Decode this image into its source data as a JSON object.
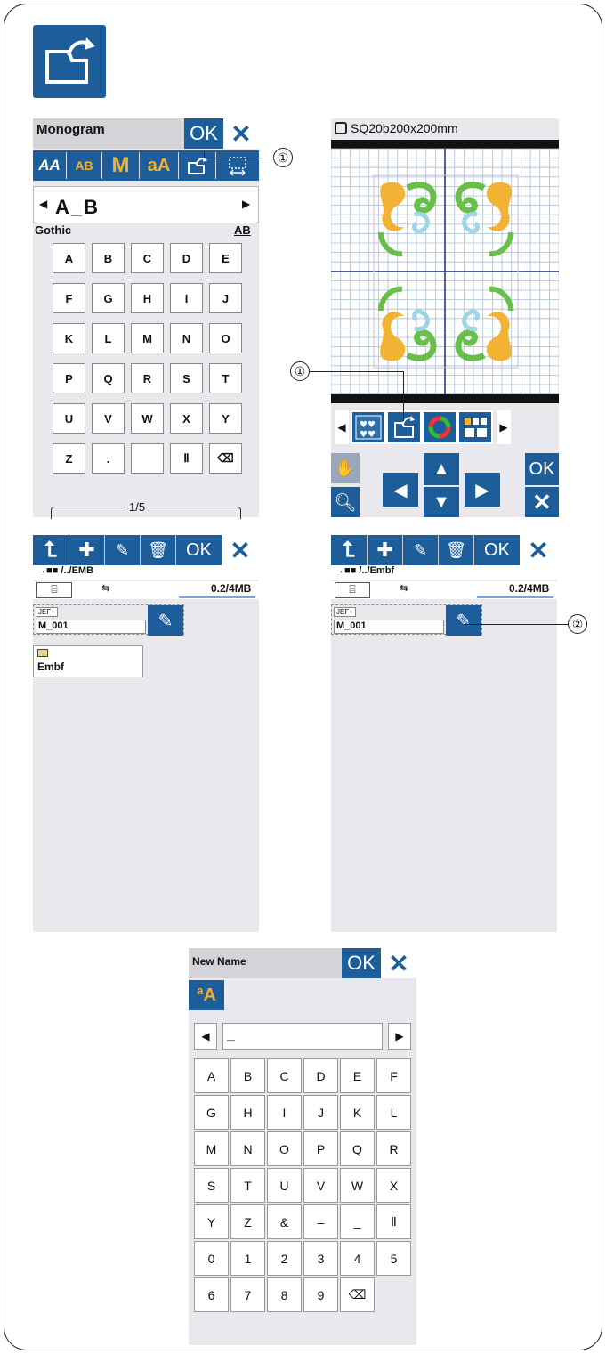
{
  "top_icon": {
    "name": "load-file-icon"
  },
  "callouts": {
    "one": "①",
    "two": "②"
  },
  "monogram": {
    "title": "Monogram",
    "ok": "OK",
    "cancel": "✕",
    "toolbar": [
      "AA",
      "AB",
      "M",
      "aA",
      "",
      ""
    ],
    "text_value": "A_B",
    "font_name": "Gothic",
    "case_indicator": "AB",
    "keys": [
      [
        "A",
        "B",
        "C",
        "D",
        "E"
      ],
      [
        "F",
        "G",
        "H",
        "I",
        "J"
      ],
      [
        "K",
        "L",
        "M",
        "N",
        "O"
      ],
      [
        "P",
        "Q",
        "R",
        "S",
        "T"
      ],
      [
        "U",
        "V",
        "W",
        "X",
        "Y"
      ],
      [
        "Z",
        ".",
        " ",
        "",
        ""
      ]
    ],
    "page": "1/5"
  },
  "editor": {
    "hoop_label": "SQ20b200x200mm",
    "ok": "OK",
    "cancel": "✕",
    "colors": {
      "gold": "#f2b233",
      "green": "#6abf4b",
      "blue": "#9fd4e6",
      "grid_line": "#a9bfd0",
      "axis": "#1f2a7a"
    }
  },
  "file_left": {
    "ok": "OK",
    "cancel": "✕",
    "path": "/../EMB",
    "capacity": "0.2/4MB",
    "file_tag": "JEF+",
    "file_name": "M_001",
    "folder_name": "Embf"
  },
  "file_right": {
    "ok": "OK",
    "cancel": "✕",
    "path": "/../Embf",
    "capacity": "0.2/4MB",
    "file_tag": "JEF+",
    "file_name": "M_001"
  },
  "newname": {
    "title": "New Name",
    "ok": "OK",
    "cancel": "✕",
    "text_value": "_",
    "keys": [
      [
        "A",
        "B",
        "C",
        "D",
        "E",
        "F"
      ],
      [
        "G",
        "H",
        "I",
        "J",
        "K",
        "L"
      ],
      [
        "M",
        "N",
        "O",
        "P",
        "Q",
        "R"
      ],
      [
        "S",
        "T",
        "U",
        "V",
        "W",
        "X"
      ],
      [
        "Y",
        "Z",
        "&",
        "–",
        "_",
        "Ⅱ"
      ],
      [
        "0",
        "1",
        "2",
        "3",
        "4",
        "5"
      ],
      [
        "6",
        "7",
        "8",
        "9",
        "⌫",
        ""
      ]
    ]
  }
}
